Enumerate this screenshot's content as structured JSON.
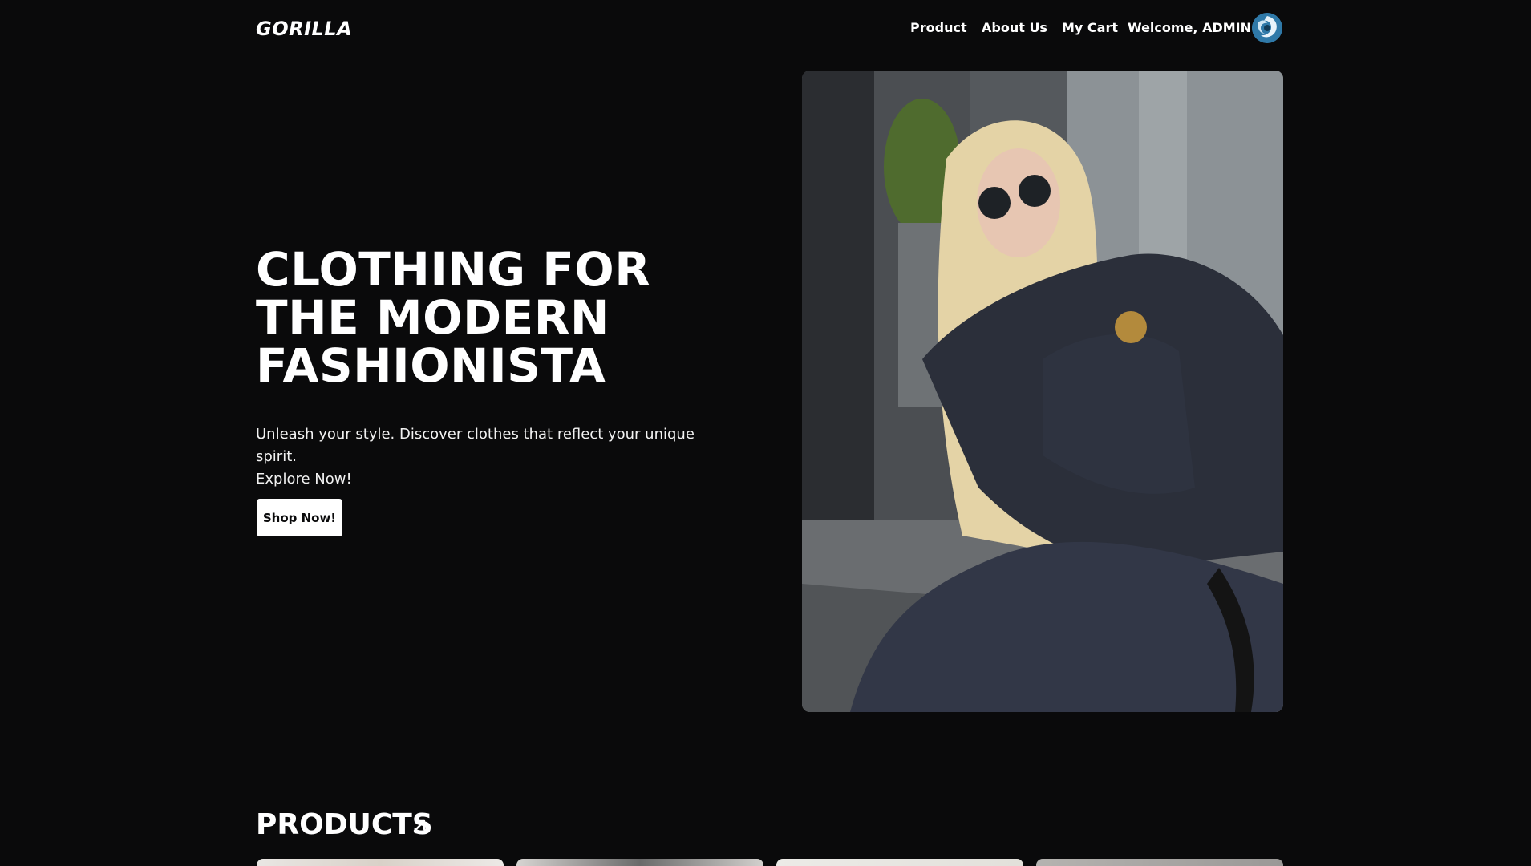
{
  "brand": {
    "logo_text": "GORILLA"
  },
  "nav": {
    "items": [
      {
        "label": "Product"
      },
      {
        "label": "About Us"
      },
      {
        "label": "My Cart"
      }
    ],
    "welcome_text": "Welcome, ADMIN",
    "avatar_icon": "avatar-icon"
  },
  "hero": {
    "title_lines": [
      "CLOTHING FOR",
      "THE MODERN",
      "FASHIONISTA"
    ],
    "subtitle_line1": "Unleash your style. Discover clothes that reflect your unique spirit.",
    "subtitle_line2": "Explore Now!",
    "cta_label": "Shop Now!",
    "image_icon": "fashion-model-photo"
  },
  "products": {
    "heading": "PRODUCTS",
    "heading_icon": "arrow-up-right-icon",
    "cards": [
      {
        "icon": "product-thumbnail"
      },
      {
        "icon": "product-thumbnail"
      },
      {
        "icon": "product-thumbnail"
      },
      {
        "icon": "product-thumbnail"
      }
    ]
  },
  "colors": {
    "background": "#0a0a0b",
    "text": "#ffffff",
    "button_bg": "#ffffff",
    "button_text": "#0a0a0b"
  }
}
